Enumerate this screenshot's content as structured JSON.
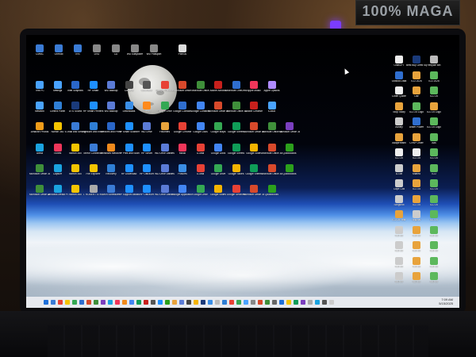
{
  "poster": {
    "text": "100% MAGA"
  },
  "taskbar": {
    "time": "7:09 AM",
    "date": "5/15/2025"
  },
  "desktop": {
    "icons": [
      {
        "label": "CMMC",
        "color": "#3a7bd5"
      },
      {
        "label": "OnHold",
        "color": "#3a7bd5"
      },
      {
        "label": "IRS",
        "color": "#3a7bd5"
      },
      {
        "label": "DVD",
        "color": "#888"
      },
      {
        "label": "CD",
        "color": "#888"
      },
      {
        "label": "WD Easystore",
        "color": "#888"
      },
      {
        "label": "WD Passport",
        "color": "#888"
      },
      {
        "label": "Pixel AI",
        "color": "#ddd"
      },
      {
        "label": "This PC",
        "color": "#4aa3ff"
      },
      {
        "label": "Settings",
        "color": "#4aa3ff"
      },
      {
        "label": "Intel Graphics",
        "color": "#2a66c9"
      },
      {
        "label": "HP Smart",
        "color": "#1e90ff"
      },
      {
        "label": "WD Backup",
        "color": "#5b7bd6"
      },
      {
        "label": "Camera",
        "color": "#444"
      },
      {
        "label": "Calculator",
        "color": "#555"
      },
      {
        "label": "Google Chrome",
        "color": "#e84135"
      },
      {
        "label": "Microsoft Office",
        "color": "#d8492b"
      },
      {
        "label": "Microsoft Office",
        "color": "#3f8f3a"
      },
      {
        "label": "Adobe Acrobat",
        "color": "#c8201c"
      },
      {
        "label": "Microsoft OneDrive",
        "color": "#2f6ecf"
      },
      {
        "label": "Apple Music",
        "color": "#f0365a"
      },
      {
        "label": "Apple Options",
        "color": "#b08cff"
      },
      {
        "label": "Network",
        "color": "#4aa3ff"
      },
      {
        "label": "Control Panel",
        "color": "#2f7fd6"
      },
      {
        "label": "DTS Sound",
        "color": "#1a3a7a"
      },
      {
        "label": "HP Smart Printers",
        "color": "#1e90ff"
      },
      {
        "label": "WD Backup",
        "color": "#5b7bd6"
      },
      {
        "label": "Downloads",
        "color": "#3a8ee6"
      },
      {
        "label": "Firefox",
        "color": "#ff8a1c"
      },
      {
        "label": "Google Drive",
        "color": "#34a853"
      },
      {
        "label": "Google Contacts",
        "color": "#2f6ecf"
      },
      {
        "label": "Google Contacts",
        "color": "#4285f4"
      },
      {
        "label": "Microsoft Office 365",
        "color": "#d8492b"
      },
      {
        "label": "Microsoft Office 365",
        "color": "#3f8f3a"
      },
      {
        "label": "Adobe Creative",
        "color": "#c8201c"
      },
      {
        "label": "iCloud",
        "color": "#4aa3ff"
      },
      {
        "label": "Amazon Photos",
        "color": "#f09c1a"
      },
      {
        "label": "Norton 360",
        "color": "#f5c400"
      },
      {
        "label": "E-mail and Settings",
        "color": "#3a7bd5"
      },
      {
        "label": "Network and Internet",
        "color": "#2f7fd6"
      },
      {
        "label": "Devices and Printers",
        "color": "#2a66c9"
      },
      {
        "label": "HP Smart Scanners",
        "color": "#1e90ff"
      },
      {
        "label": "WD Drive",
        "color": "#5b7bd6"
      },
      {
        "label": "Favorites",
        "color": "#e8a33c"
      },
      {
        "label": "Google Chrome",
        "color": "#e84135"
      },
      {
        "label": "Google Docs",
        "color": "#4285f4"
      },
      {
        "label": "Google Maps",
        "color": "#34a853"
      },
      {
        "label": "Google Sheets",
        "color": "#0f9d58"
      },
      {
        "label": "Microsoft Office 365",
        "color": "#d8492b"
      },
      {
        "label": "Microsoft Office 365",
        "color": "#3f8f3a"
      },
      {
        "label": "Microsoft Office 365",
        "color": "#7b3fbf"
      },
      {
        "label": "Alexa",
        "color": "#1aa3e0"
      },
      {
        "label": "iTunes",
        "color": "#f0365a"
      },
      {
        "label": "Norton 360",
        "color": "#f5c400"
      },
      {
        "label": "Mirror Connector",
        "color": "#3a7bd5"
      },
      {
        "label": "Windows Media Player",
        "color": "#f08a1c"
      },
      {
        "label": "HP Print and Scan",
        "color": "#1e90ff"
      },
      {
        "label": "HP Smart",
        "color": "#1e90ff"
      },
      {
        "label": "WD Drive Utilities",
        "color": "#5b7bd6"
      },
      {
        "label": "Music",
        "color": "#f0365a"
      },
      {
        "label": "G-Mail",
        "color": "#e84135"
      },
      {
        "label": "Google Docs",
        "color": "#4285f4"
      },
      {
        "label": "Google Sheets",
        "color": "#0f9d58"
      },
      {
        "label": "Google Slides",
        "color": "#f4b400"
      },
      {
        "label": "Microsoft Office 365",
        "color": "#d8492b"
      },
      {
        "label": "QuickBooks",
        "color": "#2ca01c"
      },
      {
        "label": "Microsoft Office 365",
        "color": "#3f8f3a"
      },
      {
        "label": "Capture",
        "color": "#1aa3e0"
      },
      {
        "label": "Norton 360",
        "color": "#f5c400"
      },
      {
        "label": "File Explorer",
        "color": "#f5c400"
      },
      {
        "label": "Recovery",
        "color": "#2f7fd6"
      },
      {
        "label": "HP Download",
        "color": "#1e90ff"
      },
      {
        "label": "HP OfficeJet",
        "color": "#1e90ff"
      },
      {
        "label": "WD Drive Utilities",
        "color": "#5b7bd6"
      },
      {
        "label": "Pictures",
        "color": "#3a8ee6"
      },
      {
        "label": "G-Mail",
        "color": "#e84135"
      },
      {
        "label": "Google Drive",
        "color": "#34a853"
      },
      {
        "label": "Google Slides",
        "color": "#f4b400"
      },
      {
        "label": "Google Sheets",
        "color": "#0f9d58"
      },
      {
        "label": "Microsoft Office 365",
        "color": "#d8492b"
      },
      {
        "label": "QuickBooks",
        "color": "#2ca01c"
      },
      {
        "label": "Microsoft Office 365",
        "color": "#3f8f3a"
      },
      {
        "label": "Windows Media Player",
        "color": "#1aa3e0"
      },
      {
        "label": "Norton 360",
        "color": "#f5c400"
      },
      {
        "label": "J. ROBERT STRATTON",
        "color": "#aaa"
      },
      {
        "label": "Tech Schedules",
        "color": "#3a7bd5"
      },
      {
        "label": "HP Support Assistant",
        "color": "#1e90ff"
      },
      {
        "label": "HP OfficeJet",
        "color": "#1e90ff"
      },
      {
        "label": "WD Drive Utilities",
        "color": "#5b7bd6"
      },
      {
        "label": "Google Applications",
        "color": "#4285f4"
      },
      {
        "label": "Google Drive",
        "color": "#34a853"
      },
      {
        "label": "Google Slides",
        "color": "#f4b400"
      },
      {
        "label": "Google Services",
        "color": "#e84135"
      },
      {
        "label": "Microsoft Office 365",
        "color": "#d8492b"
      },
      {
        "label": "QuickBooks",
        "color": "#2ca01c"
      },
      {
        "label": "ChatGPT",
        "color": "#eee"
      },
      {
        "label": "Best Buy Geek Squad",
        "color": "#1a3a7a"
      },
      {
        "label": "Recycle Bin",
        "color": "#bbb"
      },
      {
        "label": "Outlook Data",
        "color": "#2f6ecf"
      },
      {
        "label": "ICD 2026",
        "color": "#e8a33c"
      },
      {
        "label": "ICD 2026",
        "color": "#5cb85c"
      },
      {
        "label": "Coller Quote",
        "color": "#eee"
      },
      {
        "label": "Liar",
        "color": "#e8a33c"
      },
      {
        "label": "ICD 25",
        "color": "#5cb85c"
      },
      {
        "label": "Stop Study",
        "color": "#e8a33c"
      },
      {
        "label": "ICD 25 Logo",
        "color": "#5cb85c"
      },
      {
        "label": "ICD 25 Logo",
        "color": "#e8a33c"
      },
      {
        "label": "Ashley",
        "color": "#ccc"
      },
      {
        "label": "Anker Power",
        "color": "#2f6ecf"
      },
      {
        "label": "ICD 25 Logo",
        "color": "#5cb85c"
      },
      {
        "label": "AdaptHealth",
        "color": "#e8a33c"
      },
      {
        "label": "CPAP Order",
        "color": "#e8a33c"
      },
      {
        "label": "Ads",
        "color": "#5cb85c"
      },
      {
        "label": "ICD 25",
        "color": "#eee"
      },
      {
        "label": "ICD 25",
        "color": "#eee"
      },
      {
        "label": "ICD 25",
        "color": "#5cb85c"
      },
      {
        "label": "A-Gift",
        "color": "#ccc"
      },
      {
        "label": "shared",
        "color": "#e8a33c"
      },
      {
        "label": "ICD",
        "color": "#5cb85c"
      },
      {
        "label": "Cape Cod",
        "color": "#ccc"
      },
      {
        "label": "ICD 25",
        "color": "#e8a33c"
      },
      {
        "label": "ICD 25",
        "color": "#5cb85c"
      },
      {
        "label": "Slingshot",
        "color": "#ccc"
      },
      {
        "label": "ICD 25",
        "color": "#e8a33c"
      },
      {
        "label": "ICD 25",
        "color": "#5cb85c"
      },
      {
        "label": "ICD 25 Year",
        "color": "#e8a33c"
      },
      {
        "label": "original",
        "color": "#ccc"
      },
      {
        "label": "ICD 25",
        "color": "#5cb85c"
      },
      {
        "label": "ICD 25",
        "color": "#ccc"
      },
      {
        "label": "ICD 25",
        "color": "#e8a33c"
      },
      {
        "label": "ICD 25",
        "color": "#5cb85c"
      },
      {
        "label": "ICD 25",
        "color": "#ccc"
      },
      {
        "label": "ICD 25",
        "color": "#e8a33c"
      },
      {
        "label": "ICD 25",
        "color": "#5cb85c"
      },
      {
        "label": "ICD 25",
        "color": "#ccc"
      },
      {
        "label": "ICD 25",
        "color": "#e8a33c"
      },
      {
        "label": "ICD 25",
        "color": "#5cb85c"
      },
      {
        "label": "ICD 25",
        "color": "#ccc"
      },
      {
        "label": "ICD 25",
        "color": "#e8a33c"
      },
      {
        "label": "ICD 25",
        "color": "#5cb85c"
      }
    ]
  },
  "taskbar_icons": [
    "#1e6fd9",
    "#3a7bd5",
    "#e84135",
    "#f5c400",
    "#34a853",
    "#2f6ecf",
    "#d8492b",
    "#3f8f3a",
    "#7b3fbf",
    "#1aa3e0",
    "#f0365a",
    "#f08a1c",
    "#4285f4",
    "#0f9d58",
    "#c8201c",
    "#555",
    "#1e90ff",
    "#2ca01c",
    "#e8a33c",
    "#5b7bd6",
    "#444",
    "#f4b400",
    "#1a3a7a",
    "#3a8ee6",
    "#bbb",
    "#2f7fd6",
    "#e84135",
    "#34a853",
    "#4aa3ff",
    "#888",
    "#d8492b",
    "#3f8f3a",
    "#666",
    "#1e6fd9",
    "#f5c400",
    "#0f9d58",
    "#7b3fbf",
    "#aaa",
    "#1aa3e0",
    "#555",
    "#ccc"
  ]
}
